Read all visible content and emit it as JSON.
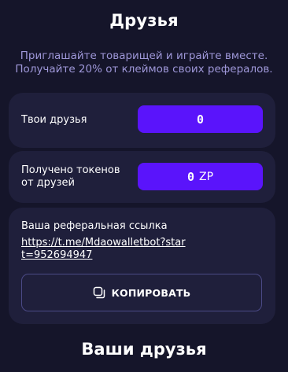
{
  "page": {
    "title": "Друзья",
    "subtitle_line1": "Приглашайте товарищей и играйте вместе.",
    "subtitle_line2": "Получайте 20% от клеймов своих рефералов."
  },
  "friends_card": {
    "label": "Твои друзья",
    "value": "0"
  },
  "tokens_card": {
    "label": "Получено токенов от друзей",
    "value": "0",
    "unit": "ZP"
  },
  "referral_card": {
    "label": "Ваша реферальная ссылка",
    "link": "https://t.me/Mdaowalletbot?start=952694947",
    "copy_button": "КОПИРОВАТЬ",
    "copy_icon": "copy-icon"
  },
  "friends_section": {
    "title": "Ваши друзья"
  },
  "colors": {
    "background": "#15152a",
    "card": "#1f1f3b",
    "accent": "#5a14fb",
    "subtitle": "#9e97d8",
    "button_border": "#4b4a86"
  }
}
